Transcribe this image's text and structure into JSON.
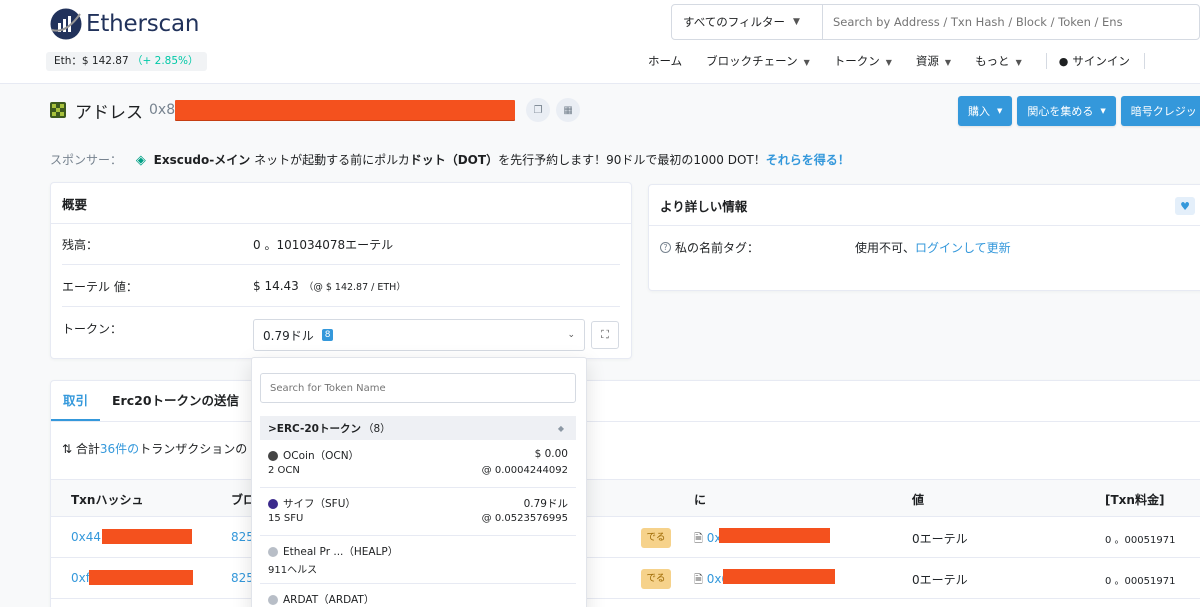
{
  "header": {
    "logo_text": "Etherscan",
    "eth_price_label": "Eth：$ 142.87",
    "eth_change": "（+ 2.85%）",
    "filter_label": "すべてのフィルター",
    "search_placeholder": "Search by Address / Txn Hash / Block / Token / Ens",
    "nav": {
      "home": "ホーム",
      "blockchain": "ブロックチェーン",
      "tokens": "トークン",
      "resources": "資源",
      "more": "もっと",
      "signin": "サインイン"
    }
  },
  "address": {
    "title": "アドレス",
    "prefix": "0x8"
  },
  "action_buttons": {
    "buy": "購入",
    "interest": "関心を集める",
    "crypto": "暗号クレジット"
  },
  "sponsor": {
    "label": "スポンサー：",
    "brand": "Exscudo-メイン",
    "text1": "ネットが起動する前にポルカ",
    "bold2": "ドット（DOT）",
    "text2": "を先行予約します！90ドルで最初の1000 DOT！",
    "link": "それらを得る！"
  },
  "overview": {
    "title": "概要",
    "balance_label": "残高：",
    "balance_value": "0 。101034078エーテル",
    "ether_value_label": "エーテル 値：",
    "ether_value": "$ 14.43",
    "ether_value_sub": "（@ $ 142.87 / ETH）",
    "token_label": "トークン：",
    "token_value": "0.79ドル",
    "token_count": "8"
  },
  "more_info": {
    "title": "より詳しい情報",
    "tag_label": "私の名前タグ：",
    "tag_value": "使用不可、",
    "tag_link": "ログインして更新"
  },
  "tx": {
    "tab_transactions": "取引",
    "tab_erc20": "Erc20トークンの送信",
    "summary_prefix": "合計",
    "summary_count": "36件の",
    "summary_suffix": "トランザクションの",
    "columns": {
      "hash": "Txnハッシュ",
      "block": "ブロ",
      "to": "に",
      "value": "値",
      "fee": "[Txn料金]"
    },
    "rows": [
      {
        "hash_prefix": "0x44",
        "block": "825",
        "direction": "でる",
        "to_prefix": "0x",
        "value": "0エーテル",
        "fee": "0 。00051971"
      },
      {
        "hash_prefix": "0xf",
        "block": "825",
        "direction": "でる",
        "to_prefix": "0x6",
        "value": "0エーテル",
        "fee": "0 。00051971"
      }
    ]
  },
  "dropdown": {
    "search_placeholder": "Search for Token Name",
    "group_label": ">ERC-20トークン",
    "group_count": "（8）",
    "items": [
      {
        "name": "OCoin（OCN）",
        "amount": "2 OCN",
        "usd": "$ 0.00",
        "rate": "@ 0.0004244092",
        "icon_color": "#444444"
      },
      {
        "name": "サイフ（SFU）",
        "amount": "15 SFU",
        "usd": "0.79ドル",
        "rate": "@ 0.0523576995",
        "icon_color": "#3b2a8c"
      },
      {
        "name": "Etheal Pr ...（HEALP）",
        "amount": "911ヘルス",
        "usd": "",
        "rate": "",
        "icon_color": "#b8bec7"
      },
      {
        "name": "ARDAT（ARDAT）",
        "amount": "",
        "usd": "",
        "rate": "",
        "icon_color": "#b8bec7"
      }
    ]
  },
  "colors": {
    "accent": "#3498db",
    "redaction": "#f4511e",
    "positive": "#00c9a7"
  }
}
